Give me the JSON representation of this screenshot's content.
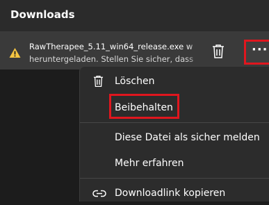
{
  "panel": {
    "title": "Downloads"
  },
  "item": {
    "filename": "RawTherapee_5.11_win64_release.exe w",
    "status": "heruntergeladen. Stellen Sie sicher, dass",
    "icons": {
      "status": "warning-icon",
      "delete": "trash-icon",
      "more": "more-options-icon"
    },
    "more_label": "···"
  },
  "menu": {
    "items": [
      {
        "label": "Löschen",
        "icon": "trash-icon"
      },
      {
        "label": "Beibehalten"
      },
      {
        "label": "Diese Datei als sicher melden"
      },
      {
        "label": "Mehr erfahren"
      },
      {
        "label": "Downloadlink kopieren",
        "icon": "link-icon"
      }
    ]
  },
  "colors": {
    "highlight": "#e0161e",
    "warning": "#f5c542"
  }
}
